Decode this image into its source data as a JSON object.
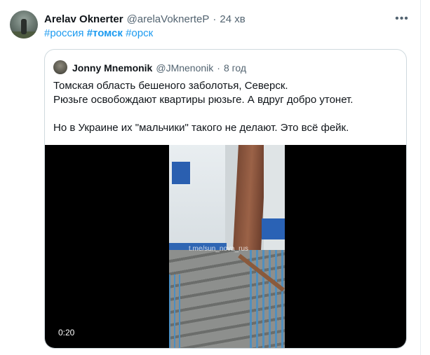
{
  "tweet": {
    "author_name": "Arelav Oknerter",
    "handle": "@arelaVoknerteP",
    "separator": "·",
    "time": "24 хв",
    "more_icon": "more-dots-icon",
    "hashtags": [
      {
        "text": "#россия",
        "bold": false
      },
      {
        "text": "#томск",
        "bold": true
      },
      {
        "text": "#орск",
        "bold": false
      }
    ]
  },
  "quoted": {
    "author_name": "Jonny Mnemonik",
    "handle": "@JMnenonik",
    "separator": "·",
    "time": "8 год",
    "lines": [
      "Томская область бешеного заболотья, Северск.",
      "Рюзьге освобождают квартиры рюзьге. А вдруг добро утонет.",
      "Но в Украине их \"мальчики\" такого не делают. Это всё фейк."
    ],
    "video": {
      "watermark": "t.me/sun_nova_rus",
      "duration": "0:20"
    }
  },
  "colors": {
    "link": "#1d9bf0",
    "muted": "#536471",
    "border": "#cfd9de",
    "text": "#0f1419"
  }
}
